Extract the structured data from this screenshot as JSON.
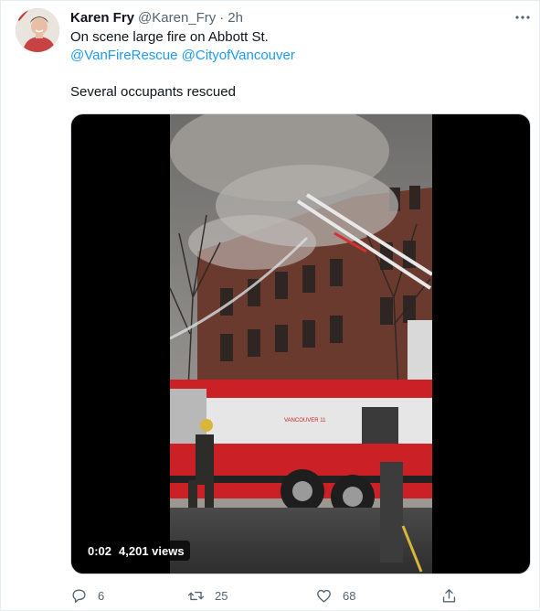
{
  "tweet": {
    "author_name": "Karen Fry",
    "author_handle": "@Karen_Fry",
    "separator": "·",
    "timestamp": "2h",
    "line1": "On scene large fire on Abbott St.",
    "mention1": "@VanFireRescue",
    "mention2": "@CityofVancouver",
    "line4": "Several occupants rescued"
  },
  "video": {
    "time": "0:02",
    "views": "4,201 views",
    "truck_text": "VANCOUVER 11"
  },
  "actions": {
    "replies": "6",
    "retweets": "25",
    "likes": "68"
  },
  "colors": {
    "link": "#1d9bf0",
    "muted": "#536471",
    "text": "#0f1419"
  },
  "icons": [
    "more-icon",
    "reply-icon",
    "retweet-icon",
    "like-icon",
    "share-icon"
  ]
}
